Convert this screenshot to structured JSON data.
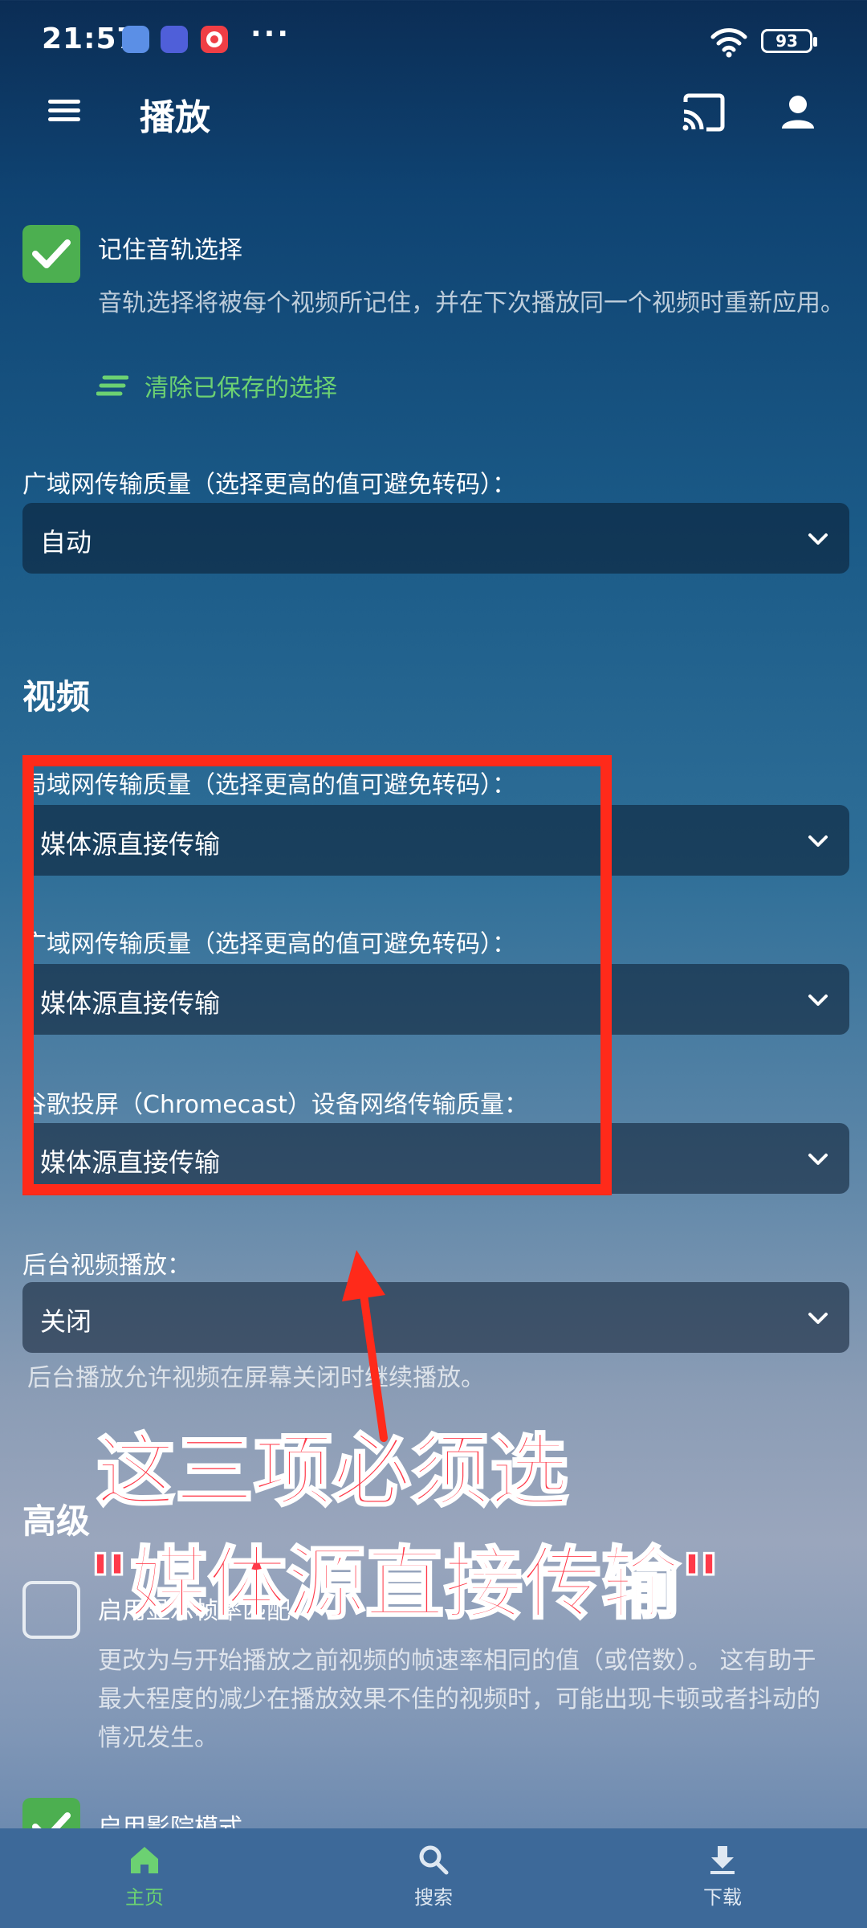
{
  "status_bar": {
    "time": "21:57",
    "more": "···",
    "battery": "93"
  },
  "header": {
    "title": "播放"
  },
  "remember_audio": {
    "title": "记住音轨选择",
    "description": "音轨选择将被每个视频所记住，并在下次播放同一个视频时重新应用。",
    "clear_link": "清除已保存的选择",
    "checked": true
  },
  "wan_audio_quality": {
    "label": "广域网传输质量（选择更高的值可避免转码）：",
    "value": "自动"
  },
  "video_section": {
    "title": "视频",
    "fields": [
      {
        "label": "局域网传输质量（选择更高的值可避免转码）：",
        "value": "媒体源直接传输"
      },
      {
        "label": "广域网传输质量（选择更高的值可避免转码）：",
        "value": "媒体源直接传输"
      },
      {
        "label": "谷歌投屏（Chromecast）设备网络传输质量：",
        "value": "媒体源直接传输"
      }
    ]
  },
  "background_play": {
    "label": "后台视频播放：",
    "value": "关闭",
    "description": "后台播放允许视频在屏幕关闭时继续播放。"
  },
  "advanced_section": {
    "title": "高级",
    "frame_rate": {
      "title": "启用显示帧率匹配",
      "description": "更改为与开始播放之前视频的帧速率相同的值（或倍数）。 这有助于最大程度的减少在播放效果不佳的视频时，可能出现卡顿或者抖动的情况发生。",
      "checked": false
    },
    "cinema_mode": {
      "title": "启用影院模式",
      "checked": true
    }
  },
  "annotation": {
    "line1": "这三项必须选",
    "line2": "\"媒体源直接传输\""
  },
  "bottom_nav": [
    {
      "label": "主页",
      "icon": "home-icon",
      "active": true
    },
    {
      "label": "搜索",
      "icon": "search-icon",
      "active": false
    },
    {
      "label": "下载",
      "icon": "download-icon",
      "active": false
    }
  ],
  "colors": {
    "accent": "#4caf50",
    "link": "#6cd172",
    "annotation": "#ff2a1a",
    "nav_bg": "#3d6999"
  }
}
